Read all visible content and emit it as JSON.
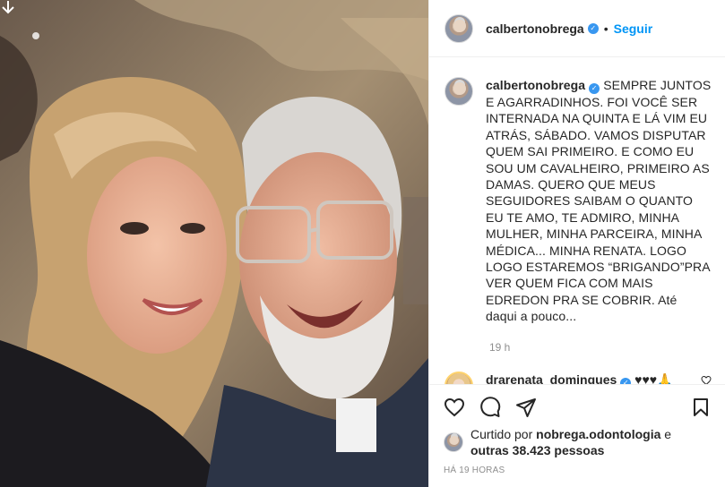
{
  "post": {
    "author": "calbertonobrega",
    "follow_label": "Seguir",
    "separator": "•",
    "caption": "SEMPRE JUNTOS E AGARRADINHOS. FOI VOCÊ SER INTERNADA NA QUINTA E LÁ VIM EU ATRÁS, SÁBADO. VAMOS DISPUTAR QUEM SAI PRIMEIRO. E COMO EU SOU UM CAVALHEIRO, PRIMEIRO AS DAMAS. QUERO QUE MEUS SEGUIDORES SAIBAM O QUANTO EU TE AMO, TE ADMIRO, MINHA MULHER, MINHA PARCEIRA, MINHA MÉDICA... MINHA RENATA. LOGO LOGO ESTAREMOS “BRIGANDO”PRA VER QUEM FICA COM MAIS EDREDON PRA SE COBRIR. Até daqui a pouco...",
    "time": "19 h",
    "comment": {
      "user": "drarenata_domingues",
      "text": "♥♥♥🙏🙏🙏"
    },
    "likes": {
      "prefix": "Curtido por",
      "by": "nobrega.odontologia",
      "and": "e",
      "others": "outras 38.423 pessoas"
    },
    "posted_ago": "HÁ 19 HORAS"
  },
  "icons": [
    "download-arrow-icon",
    "verified-badge-icon",
    "heart-icon",
    "comment-icon",
    "share-icon",
    "bookmark-icon"
  ]
}
